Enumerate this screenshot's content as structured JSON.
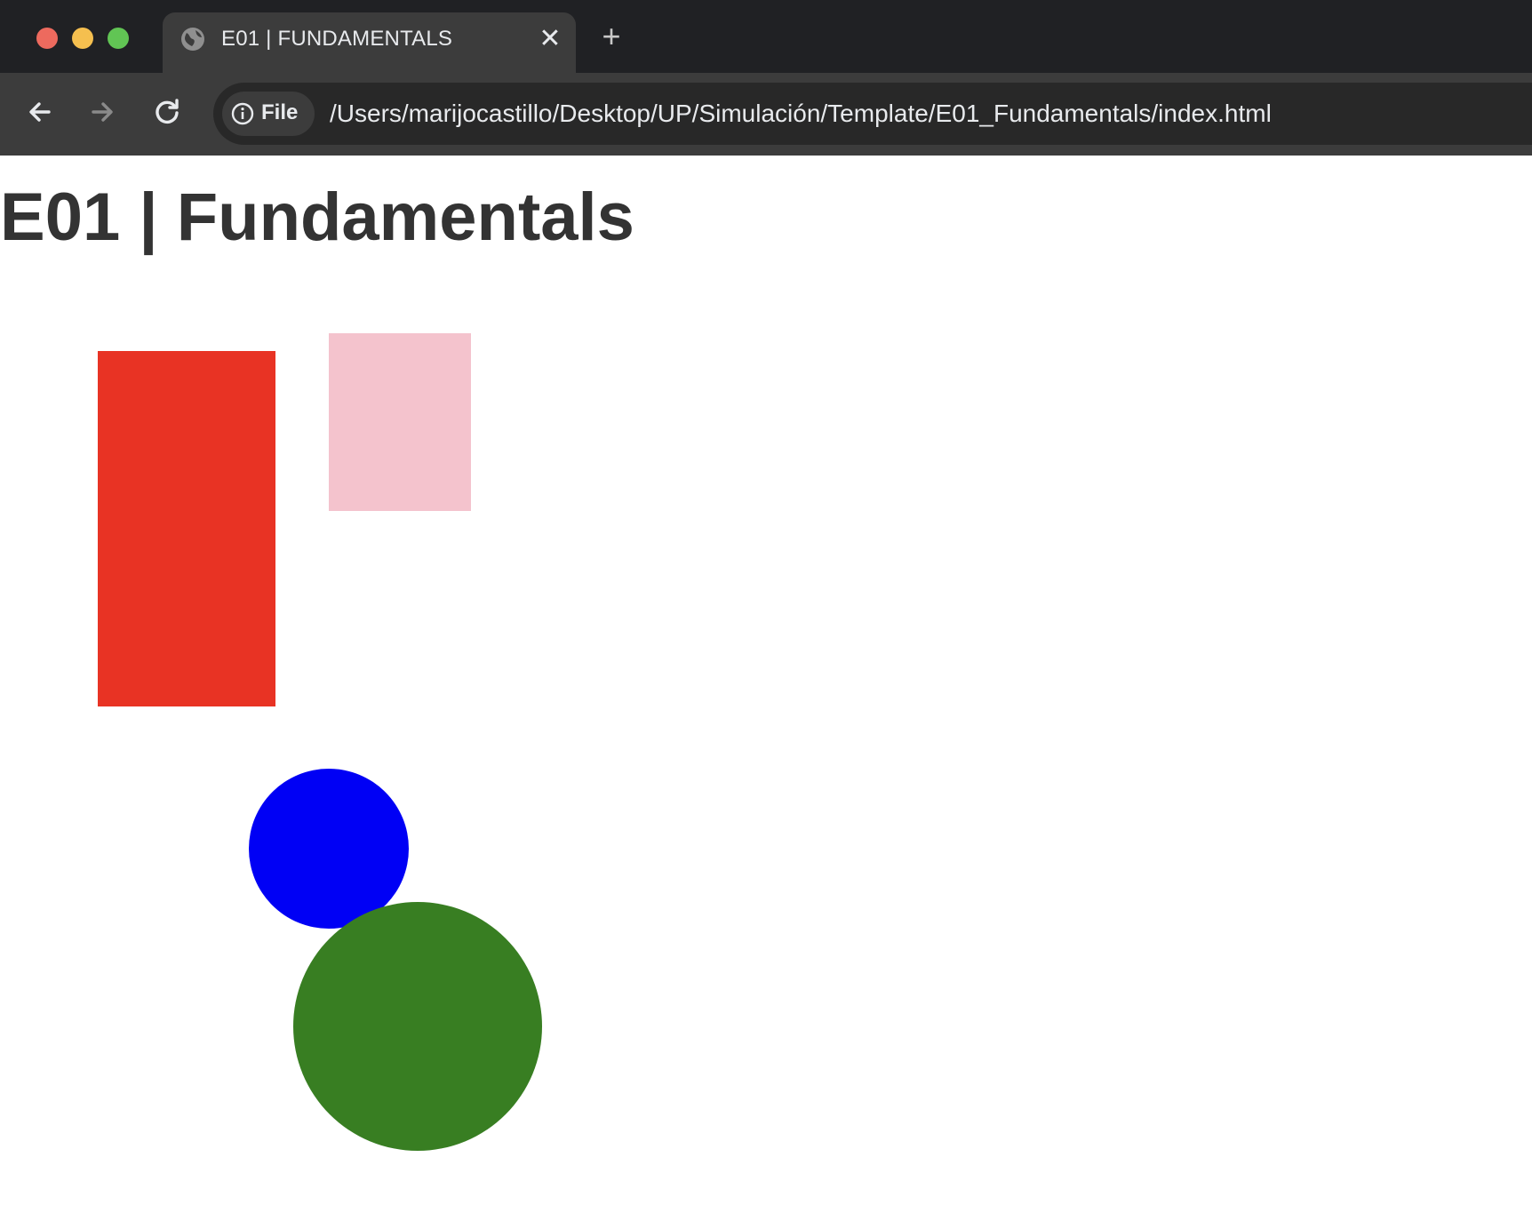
{
  "window": {
    "traffic_lights": [
      {
        "name": "close",
        "color": "#ed6a5e"
      },
      {
        "name": "minimize",
        "color": "#f5bf4f"
      },
      {
        "name": "maximize",
        "color": "#61c554"
      }
    ]
  },
  "tab": {
    "title": "E01 | FUNDAMENTALS",
    "icon": "globe-icon",
    "close_icon": "close-icon",
    "new_tab_icon": "plus-icon"
  },
  "toolbar": {
    "back_icon": "arrow-left-icon",
    "forward_icon": "arrow-right-icon",
    "reload_icon": "reload-icon",
    "address": {
      "scheme_icon": "info-icon",
      "scheme_label": "File",
      "url": "/Users/marijocastillo/Desktop/UP/Simulación/Template/E01_Fundamentals/index.html"
    }
  },
  "page": {
    "heading": "E01 | Fundamentals",
    "shapes": [
      {
        "name": "red-rectangle",
        "kind": "rect",
        "color": "#e83324"
      },
      {
        "name": "pink-rectangle",
        "kind": "rect",
        "color": "#f4c3cd"
      },
      {
        "name": "blue-circle",
        "kind": "circle",
        "color": "#0000f5"
      },
      {
        "name": "green-circle",
        "kind": "circle",
        "color": "#387e22"
      }
    ]
  }
}
